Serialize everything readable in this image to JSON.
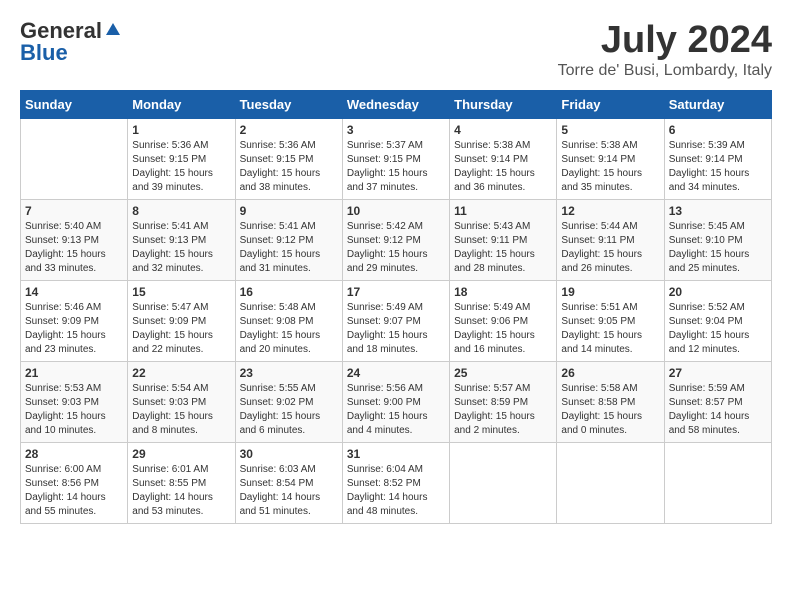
{
  "logo": {
    "general": "General",
    "blue": "Blue"
  },
  "title": "July 2024",
  "location": "Torre de' Busi, Lombardy, Italy",
  "days_of_week": [
    "Sunday",
    "Monday",
    "Tuesday",
    "Wednesday",
    "Thursday",
    "Friday",
    "Saturday"
  ],
  "weeks": [
    [
      {
        "day": "",
        "sunrise": "",
        "sunset": "",
        "daylight": "",
        "empty": true
      },
      {
        "day": "1",
        "sunrise": "Sunrise: 5:36 AM",
        "sunset": "Sunset: 9:15 PM",
        "daylight": "Daylight: 15 hours and 39 minutes."
      },
      {
        "day": "2",
        "sunrise": "Sunrise: 5:36 AM",
        "sunset": "Sunset: 9:15 PM",
        "daylight": "Daylight: 15 hours and 38 minutes."
      },
      {
        "day": "3",
        "sunrise": "Sunrise: 5:37 AM",
        "sunset": "Sunset: 9:15 PM",
        "daylight": "Daylight: 15 hours and 37 minutes."
      },
      {
        "day": "4",
        "sunrise": "Sunrise: 5:38 AM",
        "sunset": "Sunset: 9:14 PM",
        "daylight": "Daylight: 15 hours and 36 minutes."
      },
      {
        "day": "5",
        "sunrise": "Sunrise: 5:38 AM",
        "sunset": "Sunset: 9:14 PM",
        "daylight": "Daylight: 15 hours and 35 minutes."
      },
      {
        "day": "6",
        "sunrise": "Sunrise: 5:39 AM",
        "sunset": "Sunset: 9:14 PM",
        "daylight": "Daylight: 15 hours and 34 minutes."
      }
    ],
    [
      {
        "day": "7",
        "sunrise": "Sunrise: 5:40 AM",
        "sunset": "Sunset: 9:13 PM",
        "daylight": "Daylight: 15 hours and 33 minutes."
      },
      {
        "day": "8",
        "sunrise": "Sunrise: 5:41 AM",
        "sunset": "Sunset: 9:13 PM",
        "daylight": "Daylight: 15 hours and 32 minutes."
      },
      {
        "day": "9",
        "sunrise": "Sunrise: 5:41 AM",
        "sunset": "Sunset: 9:12 PM",
        "daylight": "Daylight: 15 hours and 31 minutes."
      },
      {
        "day": "10",
        "sunrise": "Sunrise: 5:42 AM",
        "sunset": "Sunset: 9:12 PM",
        "daylight": "Daylight: 15 hours and 29 minutes."
      },
      {
        "day": "11",
        "sunrise": "Sunrise: 5:43 AM",
        "sunset": "Sunset: 9:11 PM",
        "daylight": "Daylight: 15 hours and 28 minutes."
      },
      {
        "day": "12",
        "sunrise": "Sunrise: 5:44 AM",
        "sunset": "Sunset: 9:11 PM",
        "daylight": "Daylight: 15 hours and 26 minutes."
      },
      {
        "day": "13",
        "sunrise": "Sunrise: 5:45 AM",
        "sunset": "Sunset: 9:10 PM",
        "daylight": "Daylight: 15 hours and 25 minutes."
      }
    ],
    [
      {
        "day": "14",
        "sunrise": "Sunrise: 5:46 AM",
        "sunset": "Sunset: 9:09 PM",
        "daylight": "Daylight: 15 hours and 23 minutes."
      },
      {
        "day": "15",
        "sunrise": "Sunrise: 5:47 AM",
        "sunset": "Sunset: 9:09 PM",
        "daylight": "Daylight: 15 hours and 22 minutes."
      },
      {
        "day": "16",
        "sunrise": "Sunrise: 5:48 AM",
        "sunset": "Sunset: 9:08 PM",
        "daylight": "Daylight: 15 hours and 20 minutes."
      },
      {
        "day": "17",
        "sunrise": "Sunrise: 5:49 AM",
        "sunset": "Sunset: 9:07 PM",
        "daylight": "Daylight: 15 hours and 18 minutes."
      },
      {
        "day": "18",
        "sunrise": "Sunrise: 5:49 AM",
        "sunset": "Sunset: 9:06 PM",
        "daylight": "Daylight: 15 hours and 16 minutes."
      },
      {
        "day": "19",
        "sunrise": "Sunrise: 5:51 AM",
        "sunset": "Sunset: 9:05 PM",
        "daylight": "Daylight: 15 hours and 14 minutes."
      },
      {
        "day": "20",
        "sunrise": "Sunrise: 5:52 AM",
        "sunset": "Sunset: 9:04 PM",
        "daylight": "Daylight: 15 hours and 12 minutes."
      }
    ],
    [
      {
        "day": "21",
        "sunrise": "Sunrise: 5:53 AM",
        "sunset": "Sunset: 9:03 PM",
        "daylight": "Daylight: 15 hours and 10 minutes."
      },
      {
        "day": "22",
        "sunrise": "Sunrise: 5:54 AM",
        "sunset": "Sunset: 9:03 PM",
        "daylight": "Daylight: 15 hours and 8 minutes."
      },
      {
        "day": "23",
        "sunrise": "Sunrise: 5:55 AM",
        "sunset": "Sunset: 9:02 PM",
        "daylight": "Daylight: 15 hours and 6 minutes."
      },
      {
        "day": "24",
        "sunrise": "Sunrise: 5:56 AM",
        "sunset": "Sunset: 9:00 PM",
        "daylight": "Daylight: 15 hours and 4 minutes."
      },
      {
        "day": "25",
        "sunrise": "Sunrise: 5:57 AM",
        "sunset": "Sunset: 8:59 PM",
        "daylight": "Daylight: 15 hours and 2 minutes."
      },
      {
        "day": "26",
        "sunrise": "Sunrise: 5:58 AM",
        "sunset": "Sunset: 8:58 PM",
        "daylight": "Daylight: 15 hours and 0 minutes."
      },
      {
        "day": "27",
        "sunrise": "Sunrise: 5:59 AM",
        "sunset": "Sunset: 8:57 PM",
        "daylight": "Daylight: 14 hours and 58 minutes."
      }
    ],
    [
      {
        "day": "28",
        "sunrise": "Sunrise: 6:00 AM",
        "sunset": "Sunset: 8:56 PM",
        "daylight": "Daylight: 14 hours and 55 minutes."
      },
      {
        "day": "29",
        "sunrise": "Sunrise: 6:01 AM",
        "sunset": "Sunset: 8:55 PM",
        "daylight": "Daylight: 14 hours and 53 minutes."
      },
      {
        "day": "30",
        "sunrise": "Sunrise: 6:03 AM",
        "sunset": "Sunset: 8:54 PM",
        "daylight": "Daylight: 14 hours and 51 minutes."
      },
      {
        "day": "31",
        "sunrise": "Sunrise: 6:04 AM",
        "sunset": "Sunset: 8:52 PM",
        "daylight": "Daylight: 14 hours and 48 minutes."
      },
      {
        "day": "",
        "sunrise": "",
        "sunset": "",
        "daylight": "",
        "empty": true
      },
      {
        "day": "",
        "sunrise": "",
        "sunset": "",
        "daylight": "",
        "empty": true
      },
      {
        "day": "",
        "sunrise": "",
        "sunset": "",
        "daylight": "",
        "empty": true
      }
    ]
  ]
}
